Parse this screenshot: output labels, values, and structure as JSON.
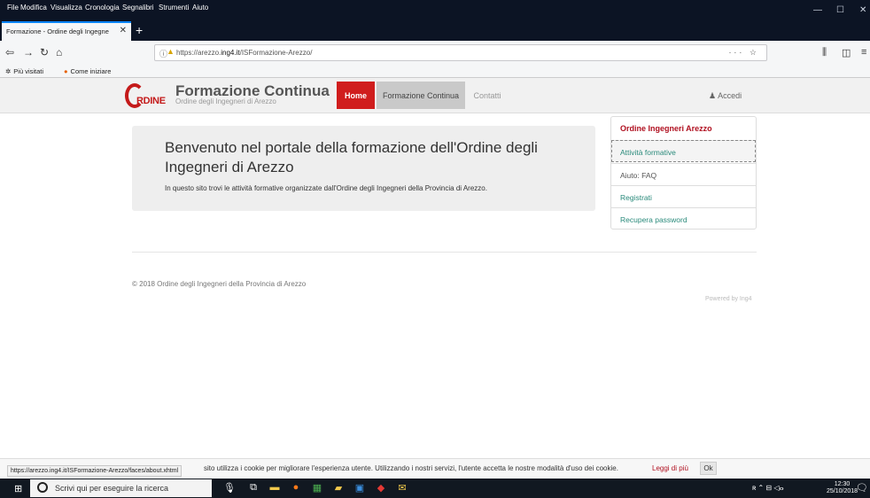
{
  "browser": {
    "menu": [
      "File",
      "Modifica",
      "Visualizza",
      "Cronologia",
      "Segnalibri",
      "Strumenti",
      "Aiuto"
    ],
    "tab_title": "Formazione - Ordine degli Ingegne",
    "url_prefix": "https://arezzo.",
    "url_domain": "ing4.it",
    "url_path": "/ISFormazione-Arezzo/",
    "bookmarks": [
      "Più visitati",
      "Come iniziare"
    ],
    "status_url": "https://arezzo.ing4.it/ISFormazione-Arezzo/faces/about.xhtml"
  },
  "site": {
    "logo_text": "RDINE",
    "title": "Formazione Continua",
    "subtitle": "Ordine degli Ingegneri di Arezzo",
    "nav": {
      "home": "Home",
      "formazione": "Formazione Continua",
      "contatti": "Contatti",
      "accedi": "Accedi"
    }
  },
  "main": {
    "welcome_title": "Benvenuto nel portale della formazione dell'Ordine degli Ingegneri di Arezzo",
    "welcome_text": "In questo sito trovi le attività formative organizzate dall'Ordine degli Ingegneri della Provincia di Arezzo.",
    "copyright": "© 2018 Ordine degli Ingegneri della Provincia di Arezzo",
    "powered_by": "Powered by Ing4"
  },
  "sidebar": {
    "header": "Ordine Ingegneri Arezzo",
    "items": [
      "Attività formative",
      "Aiuto: FAQ",
      "Registrati",
      "Recupera password"
    ]
  },
  "cookie": {
    "text": "sito utilizza i cookie per migliorare l'esperienza utente. Utilizzando i nostri servizi, l'utente accetta le nostre modalità d'uso dei cookie.",
    "more": "Leggi di più",
    "ok": "Ok"
  },
  "taskbar": {
    "search_placeholder": "Scrivi qui per eseguire la ricerca",
    "time": "12:30",
    "date": "25/10/2018"
  },
  "colors": {
    "brand_red": "#d01d1d",
    "link_teal": "#2a8a7b",
    "header_red": "#b01020"
  }
}
